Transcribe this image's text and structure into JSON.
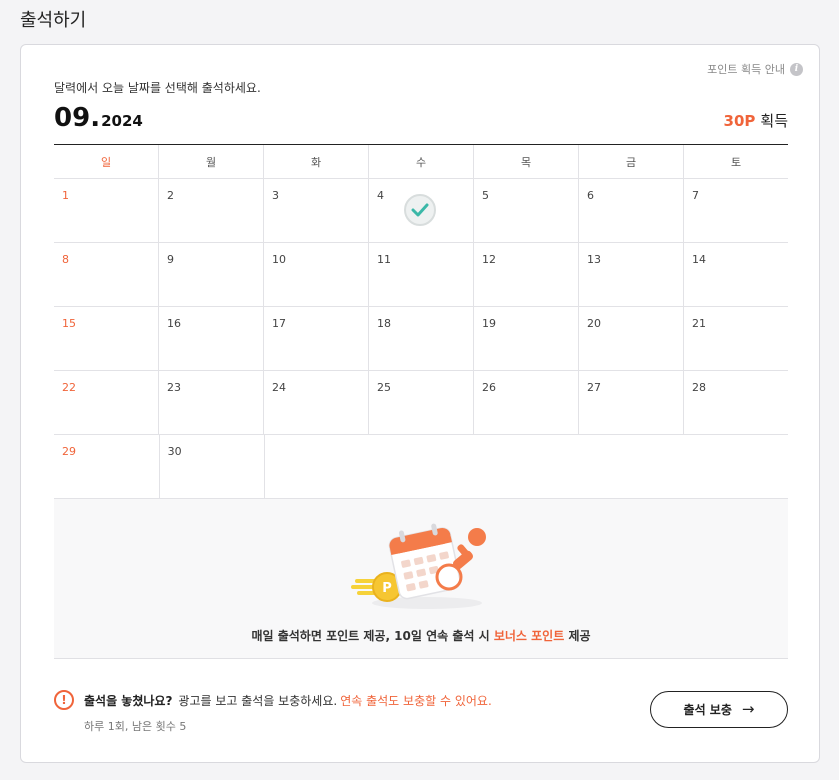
{
  "page": {
    "title": "출석하기"
  },
  "header": {
    "guide_label": "포인트 획득 안내",
    "guide_icon": "info-icon",
    "instruction": "달력에서 오늘 날짜를 선택해 출석하세요.",
    "month": "09",
    "month_separator": ".",
    "year": "2024",
    "points_value": "30P",
    "points_label": "획득"
  },
  "calendar": {
    "weekdays": [
      "일",
      "월",
      "화",
      "수",
      "목",
      "금",
      "토"
    ],
    "weeks": [
      [
        "1",
        "2",
        "3",
        "4",
        "5",
        "6",
        "7"
      ],
      [
        "8",
        "9",
        "10",
        "11",
        "12",
        "13",
        "14"
      ],
      [
        "15",
        "16",
        "17",
        "18",
        "19",
        "20",
        "21"
      ],
      [
        "22",
        "23",
        "24",
        "25",
        "26",
        "27",
        "28"
      ],
      [
        "29",
        "30",
        "",
        "",
        "",
        "",
        ""
      ]
    ],
    "checked_days": [
      "4"
    ],
    "check_icon": "check-icon"
  },
  "promo": {
    "text_before": "매일 출석하면 포인트 제공, 10일 연속 출석 시 ",
    "text_highlight": "보너스 포인트",
    "text_after": " 제공",
    "coin_letter": "P"
  },
  "missed": {
    "icon": "exclamation-icon",
    "question": "출석을 놓쳤나요?",
    "body": "광고를 보고 출석을 보충하세요.",
    "accent": "연속 출석도 보충할 수 있어요.",
    "sub": "하루 1회, 남은 횟수 5"
  },
  "makeup_button": {
    "label": "출석 보충",
    "icon": "arrow-right-icon"
  },
  "colors": {
    "accent": "#f0643a",
    "check": "#3bb8a8",
    "border": "#e2e2e6",
    "text": "#222222"
  }
}
